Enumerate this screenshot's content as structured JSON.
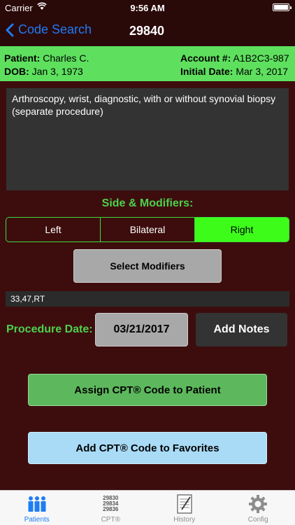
{
  "status": {
    "carrier": "Carrier",
    "time": "9:56 AM"
  },
  "nav": {
    "back_label": "Code Search",
    "title": "29840"
  },
  "patient": {
    "name_label": "Patient:",
    "name": "Charles C.",
    "dob_label": "DOB:",
    "dob": "Jan 3, 1973",
    "account_label": "Account #:",
    "account": "A1B2C3-987",
    "initial_label": "Initial Date:",
    "initial_date": "Mar 3, 2017"
  },
  "description": "Arthroscopy, wrist, diagnostic, with or without synovial biopsy (separate procedure)",
  "side": {
    "label": "Side & Modifiers:",
    "options": [
      "Left",
      "Bilateral",
      "Right"
    ],
    "selected": "Right"
  },
  "select_modifiers_label": "Select Modifiers",
  "modifiers_value": "33,47,RT",
  "procedure": {
    "label": "Procedure Date:",
    "date": "03/21/2017",
    "notes_label": "Add Notes"
  },
  "assign_label": "Assign CPT® Code to Patient",
  "favorites_label": "Add CPT® Code to Favorites",
  "tabs": [
    {
      "label": "Patients",
      "icon": "patients-icon",
      "active": true
    },
    {
      "label": "CPT®",
      "icon": "cpt-codes-icon",
      "codes": [
        "29830",
        "29834",
        "29836"
      ]
    },
    {
      "label": "History",
      "icon": "history-icon"
    },
    {
      "label": "Config",
      "icon": "gear-icon"
    }
  ],
  "colors": {
    "accent": "#1e7cf5",
    "background": "#3d0d0d",
    "patient_bar": "#5ee05e",
    "selected_segment": "#3dfc1a"
  }
}
